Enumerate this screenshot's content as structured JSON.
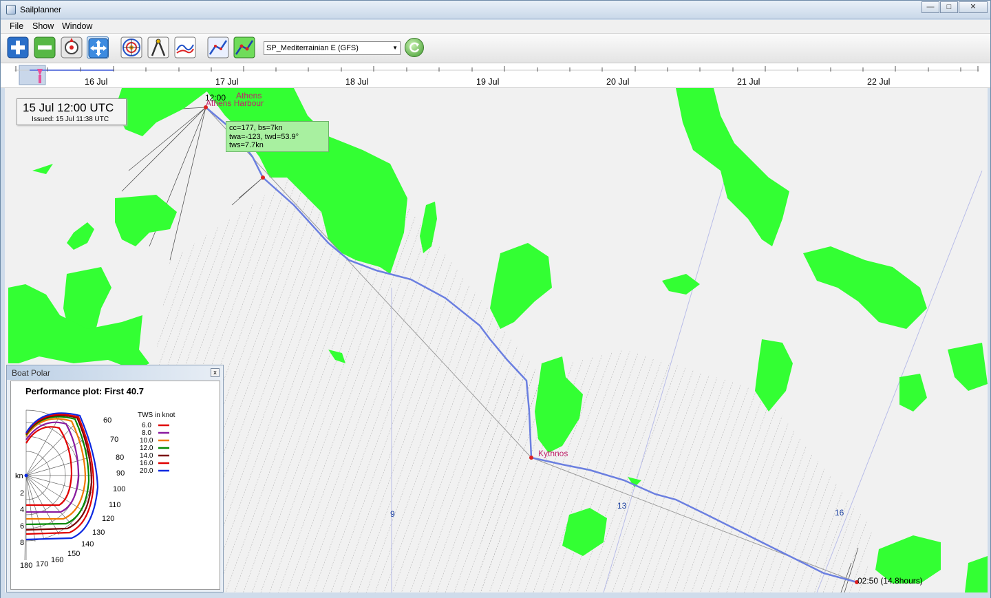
{
  "window": {
    "title": "Sailplanner",
    "minimize": "—",
    "maximize": "□",
    "close": "✕"
  },
  "menu": {
    "items": [
      "File",
      "Show",
      "Window"
    ]
  },
  "toolbar": {
    "buttons": [
      "add-icon",
      "remove-icon",
      "waypoint-icon",
      "pan-icon",
      "weather-grid-icon",
      "compass-icon",
      "graph-icon",
      "route-icon",
      "optimize-icon"
    ],
    "model_selected": "SP_Mediterrainian E (GFS)",
    "refresh_icon": "refresh-icon"
  },
  "timeline": {
    "labels": [
      "16 Jul",
      "17 Jul",
      "18 Jul",
      "19 Jul",
      "20 Jul",
      "21 Jul",
      "22 Jul"
    ]
  },
  "map": {
    "forecast_time": "15 Jul 12:00 UTC",
    "issued": "Issued: 15 Jul 11:38 UTC",
    "start_time": "12:00",
    "start_name_1": "Athens",
    "start_name_2": "Athens Harbour",
    "waypoint": "Kythnos",
    "end_label": "02:50 (14.8hours)",
    "tooltip": {
      "line1": "cc=177,  bs=7kn",
      "line2": "twa=-123, twd=53.9°",
      "line3": "tws=7.7kn"
    },
    "isochrone_labels": [
      "9",
      "13",
      "16"
    ],
    "colors": {
      "land": "#33ff33",
      "sea": "#f1f1f1",
      "route": "#6b7fe0",
      "label": "#c0246b"
    }
  },
  "polar": {
    "panel_title": "Boat Polar",
    "close": "x",
    "heading": "Performance plot: First 40.7",
    "legend_title": "TWS in knot",
    "tws": [
      {
        "label": "6.0",
        "color": "#e00000"
      },
      {
        "label": "8.0",
        "color": "#8a1aa0"
      },
      {
        "label": "10.0",
        "color": "#f07800"
      },
      {
        "label": "12.0",
        "color": "#008a00"
      },
      {
        "label": "14.0",
        "color": "#7a0000"
      },
      {
        "label": "16.0",
        "color": "#e00000"
      },
      {
        "label": "20.0",
        "color": "#0a28e0"
      }
    ],
    "angle_labels": [
      "60",
      "70",
      "80",
      "90",
      "100",
      "110",
      "120",
      "130",
      "140",
      "150",
      "160",
      "170",
      "180"
    ],
    "speed_labels": [
      "kn",
      "2",
      "4",
      "6",
      "8"
    ]
  }
}
